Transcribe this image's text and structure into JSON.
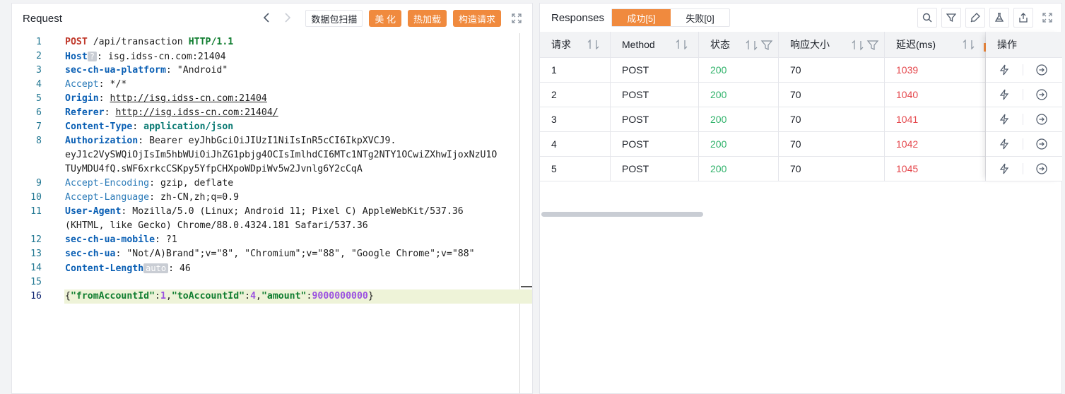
{
  "request": {
    "title": "Request",
    "btn_scan": "数据包扫描",
    "btn_beautify": "美 化",
    "btn_hotload": "热加载",
    "btn_build": "构造请求"
  },
  "responses": {
    "title": "Responses",
    "tab_success": "成功[5]",
    "tab_fail": "失败[0]",
    "columns": [
      "请求",
      "Method",
      "状态",
      "响应大小",
      "延迟(ms)"
    ],
    "ops_header": "操作",
    "rows": [
      {
        "id": "1",
        "method": "POST",
        "status": "200",
        "size": "70",
        "latency": "1039"
      },
      {
        "id": "2",
        "method": "POST",
        "status": "200",
        "size": "70",
        "latency": "1040"
      },
      {
        "id": "3",
        "method": "POST",
        "status": "200",
        "size": "70",
        "latency": "1041"
      },
      {
        "id": "4",
        "method": "POST",
        "status": "200",
        "size": "70",
        "latency": "1042"
      },
      {
        "id": "5",
        "method": "POST",
        "status": "200",
        "size": "70",
        "latency": "1045"
      }
    ]
  },
  "editor": {
    "line_numbers": [
      "1",
      "2",
      "3",
      "4",
      "5",
      "6",
      "7",
      "8",
      "9",
      "10",
      "11",
      "12",
      "13",
      "14",
      "15",
      "16"
    ],
    "l1_method": "POST",
    "l1_path": " /api/transaction ",
    "l1_proto": "HTTP/1.1",
    "l2_key": "Host",
    "l2_tag": "?",
    "l2_val": ": isg.idss-cn.com:21404",
    "l3_key": "sec-ch-ua-platform",
    "l3_val": ": \"Android\"",
    "l4_key": "Accept",
    "l4_val": ": */*",
    "l5_key": "Origin",
    "l5_sep": ": ",
    "l5_val": "http://isg.idss-cn.com:21404",
    "l6_key": "Referer",
    "l6_sep": ": ",
    "l6_val": "http://isg.idss-cn.com:21404/",
    "l7_key": "Content-Type",
    "l7_sep": ": ",
    "l7_val": "application/json",
    "l8_key": "Authorization",
    "l8_val": ": Bearer eyJhbGciOiJIUzI1NiIsInR5cCI6IkpXVCJ9.",
    "l8_w1": "eyJ1c2VySWQiOjIsIm5hbWUiOiJhZG1pbjg4OCIsImlhdCI6MTc1NTg2NTY1OCwiZXhwIjoxNzU1O",
    "l8_w2": "TUyMDU4fQ.sWF6xrkcCSKpy5YfpCHXpoWDpiWv5w2Jvnlg6Y2cCqA",
    "l9_key": "Accept-Encoding",
    "l9_val": ": gzip, deflate",
    "l10_key": "Accept-Language",
    "l10_val": ": zh-CN,zh;q=0.9",
    "l11_key": "User-Agent",
    "l11_val": ": Mozilla/5.0 (Linux; Android 11; Pixel C) AppleWebKit/537.36",
    "l11_w1": "(KHTML, like Gecko) Chrome/88.0.4324.181 Safari/537.36",
    "l12_key": "sec-ch-ua-mobile",
    "l12_val": ": ?1",
    "l13_key": "sec-ch-ua",
    "l13_val": ": \"Not/A)Brand\";v=\"8\", \"Chromium\";v=\"88\", \"Google Chrome\";v=\"88\"",
    "l14_key": "Content-Length",
    "l14_tag": "auto",
    "l14_val": ": 46",
    "l16_b1": "{",
    "l16_k1": "\"fromAccountId\"",
    "l16_c1": ":",
    "l16_v1": "1",
    "l16_c2": ",",
    "l16_k2": "\"toAccountId\"",
    "l16_c3": ":",
    "l16_v2": "4",
    "l16_c4": ",",
    "l16_k3": "\"amount\"",
    "l16_c5": ":",
    "l16_v3": "9000000000",
    "l16_b2": "}"
  }
}
